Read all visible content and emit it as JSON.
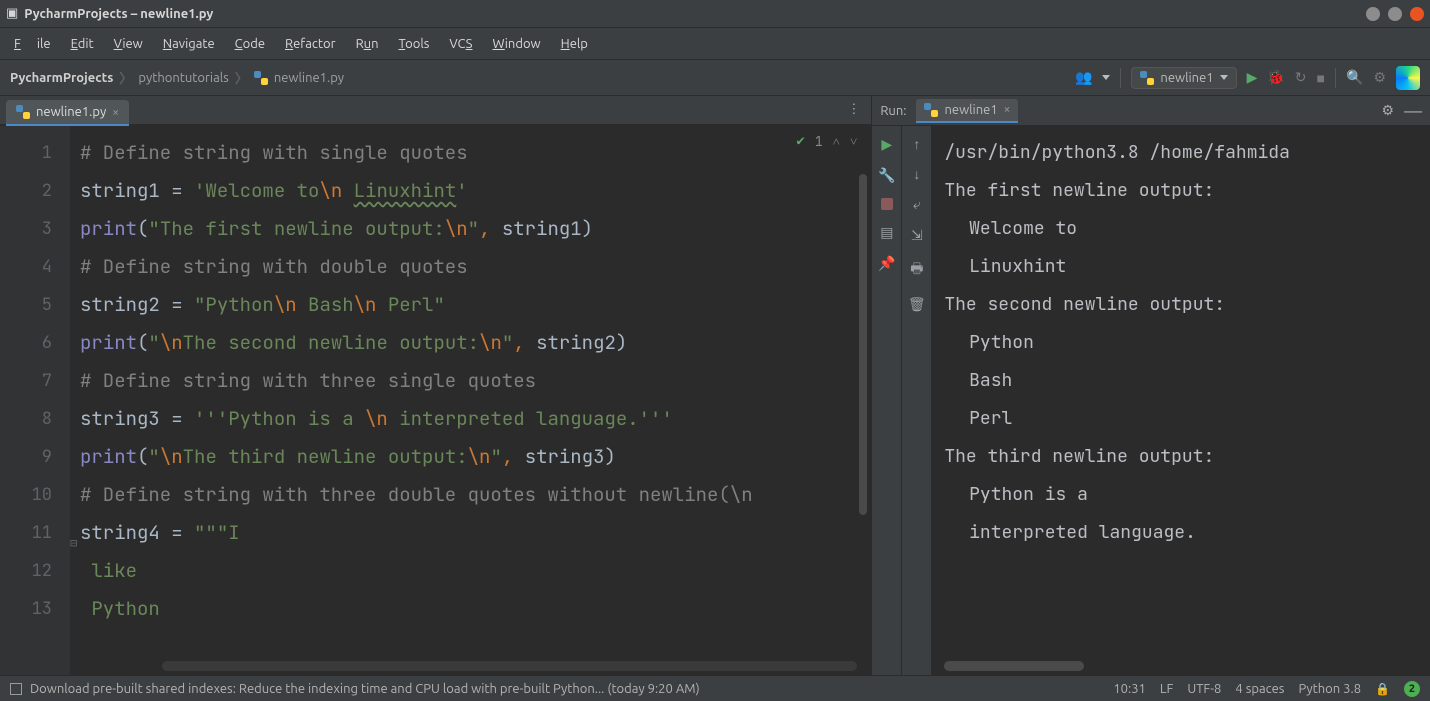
{
  "window": {
    "title": "PycharmProjects – newline1.py"
  },
  "menu": {
    "file": "File",
    "edit": "Edit",
    "view": "View",
    "navigate": "Navigate",
    "code": "Code",
    "refactor": "Refactor",
    "run": "Run",
    "tools": "Tools",
    "vcs": "VCS",
    "window": "Window",
    "help": "Help"
  },
  "breadcrumb": {
    "root": "PycharmProjects",
    "folder": "pythontutorials",
    "file": "newline1.py"
  },
  "toolbar": {
    "run_config": "newline1"
  },
  "editor": {
    "tab": "newline1.py",
    "inspection_count": "1",
    "lines": [
      "1",
      "2",
      "3",
      "4",
      "5",
      "6",
      "7",
      "8",
      "9",
      "10",
      "11",
      "12",
      "13"
    ],
    "code": {
      "l1": "# Define string with single quotes",
      "l2a": "string1 ",
      "l2op": "=",
      "l2b": " ",
      "l2s1": "'Welcome to",
      "l2esc": "\\n",
      "l2s2": " ",
      "l2linux": "Linuxhint",
      "l2s3": "'",
      "l3f": "print",
      "l3p1": "(",
      "l3s": "\"The first newline output:",
      "l3esc": "\\n",
      "l3s2": "\"",
      "l3c": ", ",
      "l3v": "string1",
      "l3p2": ")",
      "l4": "# Define string with double quotes",
      "l5a": "string2 ",
      "l5op": "=",
      "l5b": " ",
      "l5s1": "\"Python",
      "l5e1": "\\n",
      "l5s2": " Bash",
      "l5e2": "\\n",
      "l5s3": " Perl\"",
      "l6f": "print",
      "l6p1": "(",
      "l6s1": "\"",
      "l6e1": "\\n",
      "l6s2": "The second newline output:",
      "l6e2": "\\n",
      "l6s3": "\"",
      "l6c": ", ",
      "l6v": "string2",
      "l6p2": ")",
      "l7": "# Define string with three single quotes",
      "l8a": "string3 ",
      "l8op": "=",
      "l8b": " ",
      "l8s1": "'''Python is a ",
      "l8e": "\\n",
      "l8s2": " interpreted language.'''",
      "l9f": "print",
      "l9p1": "(",
      "l9s1": "\"",
      "l9e1": "\\n",
      "l9s2": "The third newline output:",
      "l9e2": "\\n",
      "l9s3": "\"",
      "l9c": ", ",
      "l9v": "string3",
      "l9p2": ")",
      "l10": "# Define string with three double quotes without newline(\\n",
      "l11a": "string4 ",
      "l11op": "=",
      "l11b": " ",
      "l11s": "\"\"\"I",
      "l12s": " like",
      "l13s": " Python"
    }
  },
  "run": {
    "label": "Run:",
    "tab": "newline1",
    "output": {
      "cmd": "/usr/bin/python3.8 /home/fahmida",
      "o1": "The first newline output:",
      "o2": " Welcome to",
      "o3": " Linuxhint",
      "blank": "",
      "o4": "The second newline output:",
      "o5": " Python",
      "o6": " Bash",
      "o7": " Perl",
      "o8": "The third newline output:",
      "o9": " Python is a ",
      "o10": " interpreted language."
    }
  },
  "status": {
    "msg": "Download pre-built shared indexes: Reduce the indexing time and CPU load with pre-built Python... (today 9:20 AM)",
    "caret": "10:31",
    "sep": "LF",
    "enc": "UTF-8",
    "indent": "4 spaces",
    "interp": "Python 3.8",
    "badge": "2"
  }
}
